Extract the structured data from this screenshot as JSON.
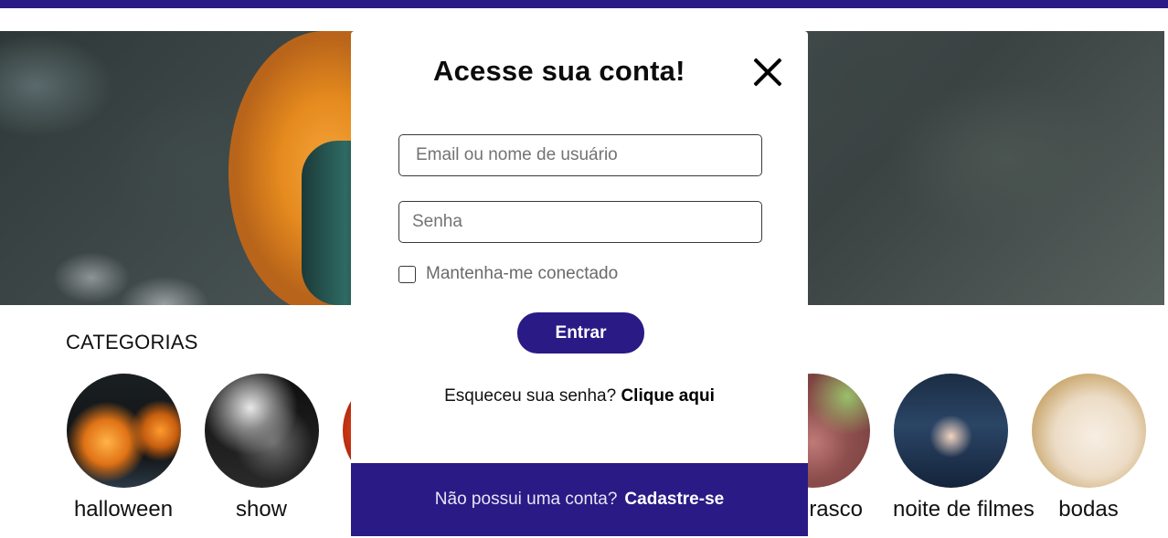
{
  "categories": {
    "title": "CATEGORIAS",
    "items": [
      {
        "label": "halloween"
      },
      {
        "label": "show"
      },
      {
        "label": ""
      },
      {
        "label": "rasco"
      },
      {
        "label": "noite de filmes"
      },
      {
        "label": "bodas"
      }
    ]
  },
  "modal": {
    "title": "Acesse sua conta!",
    "email_placeholder": "Email ou nome de usuário",
    "password_placeholder": "Senha",
    "remember_label": "Mantenha-me conectado",
    "login_label": "Entrar",
    "forgot_text": "Esqueceu sua senha?",
    "forgot_link": "Clique aqui",
    "footer_text": "Não possui uma conta?",
    "footer_link": "Cadastre-se"
  },
  "colors": {
    "brand": "#2a1a85"
  },
  "icons": {
    "close": "close-icon"
  }
}
